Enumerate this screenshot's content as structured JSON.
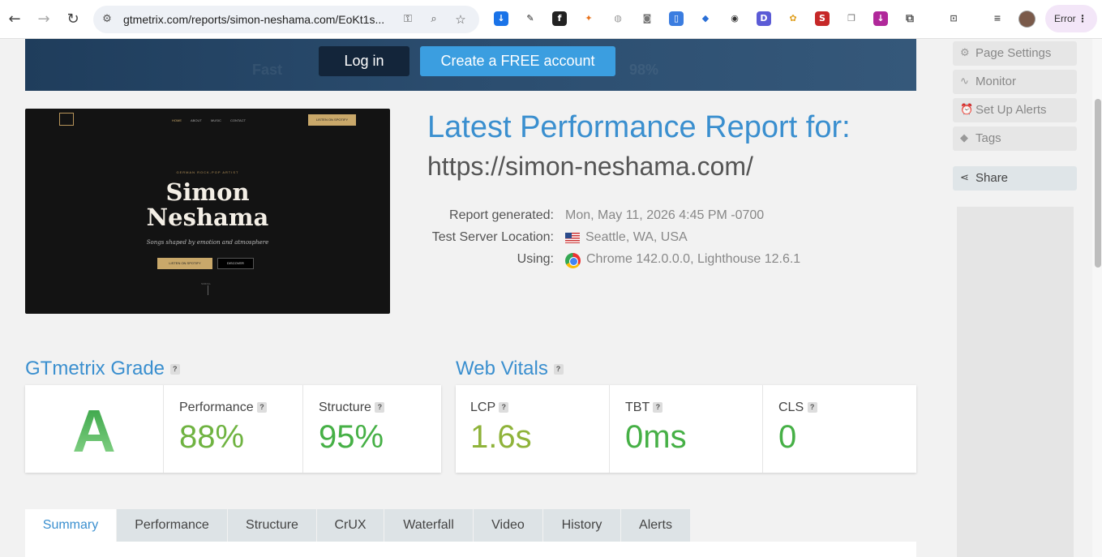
{
  "browser": {
    "url": "gtmetrix.com/reports/simon-neshama.com/EoKt1s...",
    "profile_status": "Error"
  },
  "banner": {
    "login_label": "Log in",
    "create_label": "Create a FREE account"
  },
  "thumbnail": {
    "nav": [
      "HOME",
      "ABOUT",
      "MUSIC",
      "CONTACT"
    ],
    "spotify_button": "LISTEN ON SPOTIFY",
    "subtitle": "GERMAN ROCK-POP ARTIST",
    "name_line1": "Simon",
    "name_line2": "Neshama",
    "tagline": "Songs shaped by emotion and atmosphere",
    "button_listen": "LISTEN ON SPOTIFY",
    "button_discover": "DISCOVER",
    "scroll_label": "SCROLL"
  },
  "report": {
    "title": "Latest Performance Report for:",
    "url": "https://simon-neshama.com/",
    "generated_label": "Report generated:",
    "generated_value": "Mon, May 11, 2026 4:45 PM -0700",
    "location_label": "Test Server Location:",
    "location_value": "Seattle, WA, USA",
    "using_label": "Using:",
    "using_value": "Chrome 142.0.0.0, Lighthouse 12.6.1"
  },
  "grade": {
    "title": "GTmetrix Grade",
    "letter": "A",
    "performance_label": "Performance",
    "performance_value": "88%",
    "structure_label": "Structure",
    "structure_value": "95%"
  },
  "vitals": {
    "title": "Web Vitals",
    "lcp_label": "LCP",
    "lcp_value": "1.6s",
    "tbt_label": "TBT",
    "tbt_value": "0ms",
    "cls_label": "CLS",
    "cls_value": "0"
  },
  "help_glyph": "?",
  "tabs": [
    "Summary",
    "Performance",
    "Structure",
    "CrUX",
    "Waterfall",
    "Video",
    "History",
    "Alerts"
  ],
  "sidebar": {
    "page_settings": "Page Settings",
    "monitor": "Monitor",
    "alerts": "Set Up Alerts",
    "tags": "Tags",
    "share": "Share"
  },
  "colors": {
    "accent": "#3a8fcf",
    "good": "#6fb341",
    "grade_a": "#46b046",
    "lcp": "#8fb33a"
  }
}
